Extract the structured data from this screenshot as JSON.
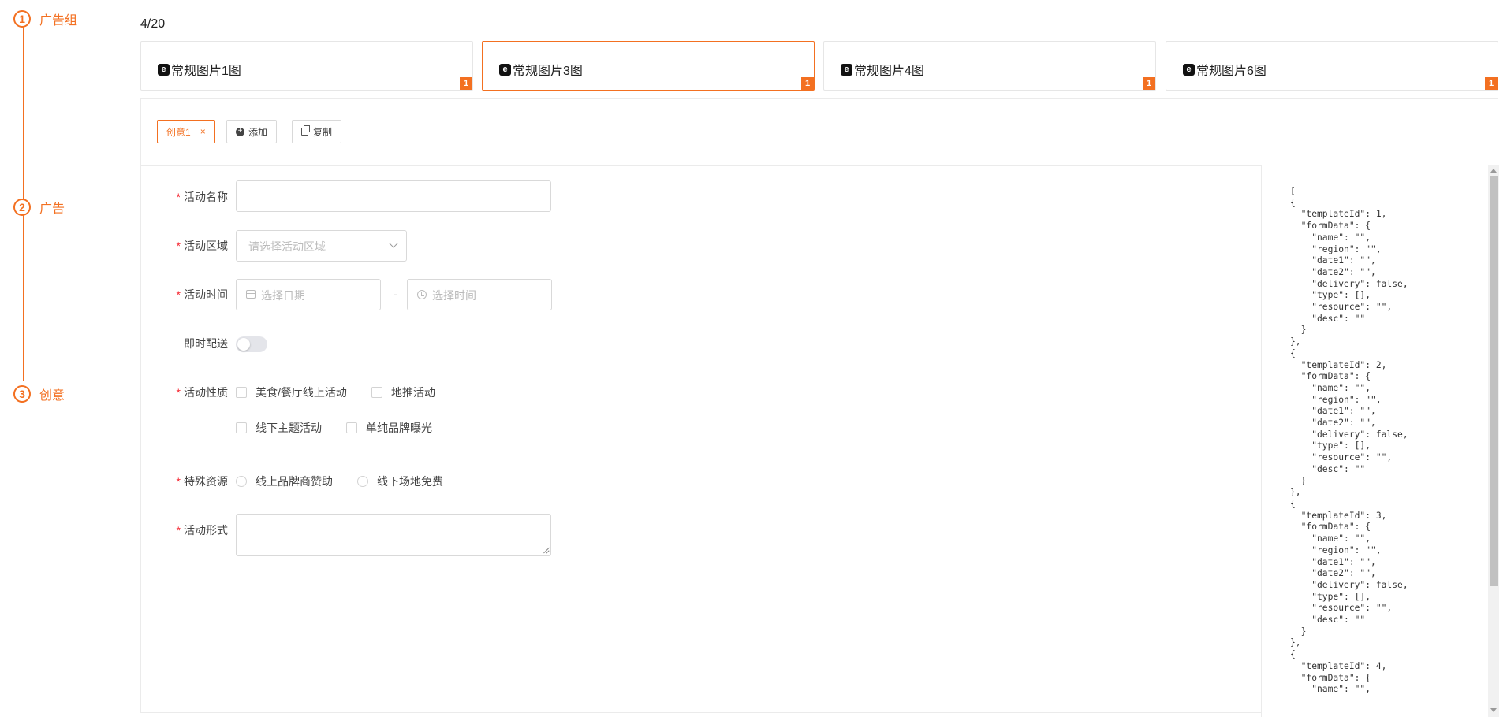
{
  "steps": [
    {
      "num": "1",
      "label": "广告组"
    },
    {
      "num": "2",
      "label": "广告"
    },
    {
      "num": "3",
      "label": "创意"
    }
  ],
  "counter": "4/20",
  "cards": [
    {
      "icon": "e",
      "title": "常规图片1图",
      "badge": "1"
    },
    {
      "icon": "e",
      "title": "常规图片3图",
      "badge": "1"
    },
    {
      "icon": "e",
      "title": "常规图片4图",
      "badge": "1"
    },
    {
      "icon": "e",
      "title": "常规图片6图",
      "badge": "1"
    }
  ],
  "creative": {
    "tag_label": "创意1",
    "tag_close": "×",
    "add_label": "添加",
    "copy_label": "复制"
  },
  "form": {
    "required_mark": "*",
    "name_label": "活动名称",
    "name_value": "",
    "region_label": "活动区域",
    "region_placeholder": "请选择活动区域",
    "time_label": "活动时间",
    "date_placeholder": "选择日期",
    "time_sep": "-",
    "time_placeholder": "选择时间",
    "delivery_label": "即时配送",
    "delivery_on": false,
    "type_label": "活动性质",
    "type_options": [
      "美食/餐厅线上活动",
      "地推活动",
      "线下主题活动",
      "单纯品牌曝光"
    ],
    "resource_label": "特殊资源",
    "resource_options": [
      "线上品牌商赞助",
      "线下场地免费"
    ],
    "desc_label": "活动形式",
    "desc_value": ""
  },
  "json_preview": "[\n{\n  \"templateId\": 1,\n  \"formData\": {\n    \"name\": \"\",\n    \"region\": \"\",\n    \"date1\": \"\",\n    \"date2\": \"\",\n    \"delivery\": false,\n    \"type\": [],\n    \"resource\": \"\",\n    \"desc\": \"\"\n  }\n},\n{\n  \"templateId\": 2,\n  \"formData\": {\n    \"name\": \"\",\n    \"region\": \"\",\n    \"date1\": \"\",\n    \"date2\": \"\",\n    \"delivery\": false,\n    \"type\": [],\n    \"resource\": \"\",\n    \"desc\": \"\"\n  }\n},\n{\n  \"templateId\": 3,\n  \"formData\": {\n    \"name\": \"\",\n    \"region\": \"\",\n    \"date1\": \"\",\n    \"date2\": \"\",\n    \"delivery\": false,\n    \"type\": [],\n    \"resource\": \"\",\n    \"desc\": \"\"\n  }\n},\n{\n  \"templateId\": 4,\n  \"formData\": {\n    \"name\": \"\",",
  "colors": {
    "accent": "#f37021",
    "required": "#f5222d",
    "border": "#d9d9d9"
  }
}
